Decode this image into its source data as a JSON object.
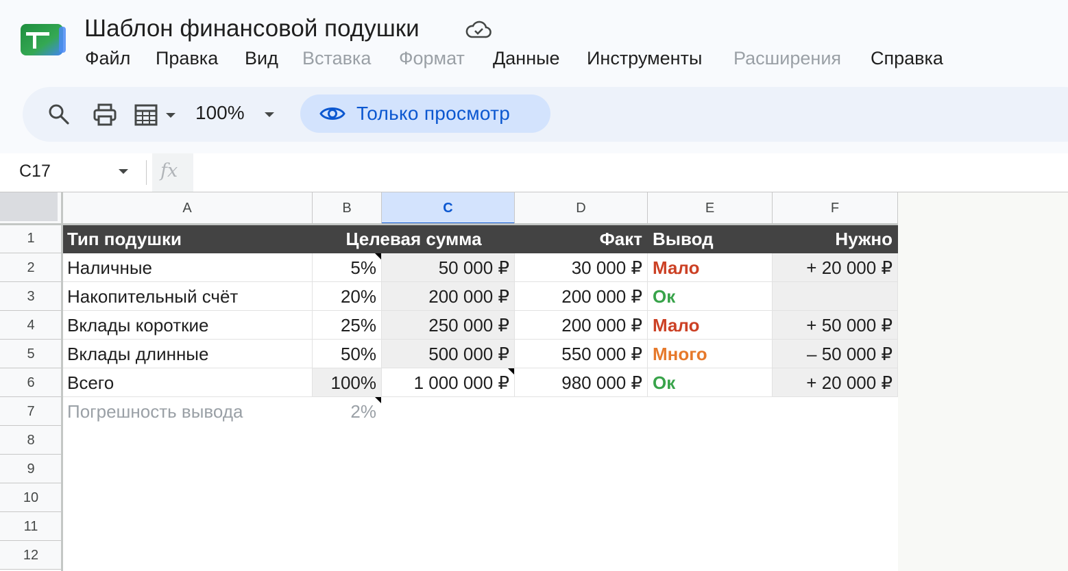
{
  "app": {
    "title": "Шаблон финансовой подушки"
  },
  "menu": [
    {
      "label": "Файл",
      "disabled": false
    },
    {
      "label": "Правка",
      "disabled": false
    },
    {
      "label": "Вид",
      "disabled": false
    },
    {
      "label": "Вставка",
      "disabled": true
    },
    {
      "label": "Формат",
      "disabled": true
    },
    {
      "label": "Данные",
      "disabled": false
    },
    {
      "label": "Инструменты",
      "disabled": false
    },
    {
      "label": "Расширения",
      "disabled": true
    },
    {
      "label": "Справка",
      "disabled": false
    }
  ],
  "toolbar": {
    "zoom": "100%",
    "view_only_label": "Только просмотр"
  },
  "formula_bar": {
    "name_box": "C17",
    "fx": "fx",
    "content": ""
  },
  "sheet": {
    "columns": [
      "A",
      "B",
      "C",
      "D",
      "E",
      "F"
    ],
    "selected_column": "C",
    "rows": [
      "1",
      "2",
      "3",
      "4",
      "5",
      "6",
      "7",
      "8",
      "9",
      "10",
      "11",
      "12"
    ],
    "header": {
      "a": "Тип подушки",
      "b": "Целевая сумма",
      "d": "Факт",
      "e": "Вывод",
      "f": "Нужно"
    },
    "data": [
      {
        "a": "Наличные",
        "b": "5%",
        "c": "50 000 ₽",
        "d": "30 000 ₽",
        "e": "Мало",
        "e_status": "low",
        "f": "+ 20 000 ₽"
      },
      {
        "a": "Накопительный счёт",
        "b": "20%",
        "c": "200 000 ₽",
        "d": "200 000 ₽",
        "e": "Ок",
        "e_status": "ok",
        "f": ""
      },
      {
        "a": "Вклады короткие",
        "b": "25%",
        "c": "250 000 ₽",
        "d": "200 000 ₽",
        "e": "Мало",
        "e_status": "low",
        "f": "+ 50 000 ₽"
      },
      {
        "a": "Вклады длинные",
        "b": "50%",
        "c": "500 000 ₽",
        "d": "550 000 ₽",
        "e": "Много",
        "e_status": "high",
        "f": "– 50 000 ₽"
      },
      {
        "a": "Всего",
        "b": "100%",
        "c": "1 000 000 ₽",
        "d": "980 000 ₽",
        "e": "Ок",
        "e_status": "ok",
        "f": "+ 20 000 ₽"
      }
    ],
    "footnote": {
      "a": "Погрешность вывода",
      "b": "2%"
    }
  },
  "colors": {
    "header_bg": "#434343",
    "low": "#cc4125",
    "ok": "#38a34a",
    "high": "#e6792b",
    "accent": "#0b57d0"
  }
}
